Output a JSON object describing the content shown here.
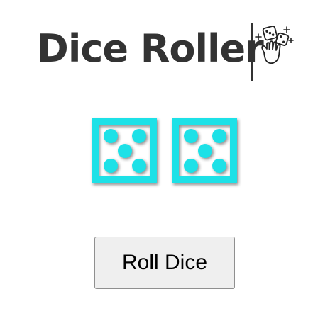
{
  "header": {
    "title": "Dice Roller",
    "icon": "hand-rolling-dice-icon"
  },
  "dice": [
    {
      "value": 5,
      "icon": "dice-five-icon"
    },
    {
      "value": 5,
      "icon": "dice-five-icon"
    }
  ],
  "controls": {
    "roll_label": "Roll Dice"
  },
  "colors": {
    "die_face": "#1de1e7",
    "title_text": "#333333",
    "button_bg": "#efefef"
  }
}
